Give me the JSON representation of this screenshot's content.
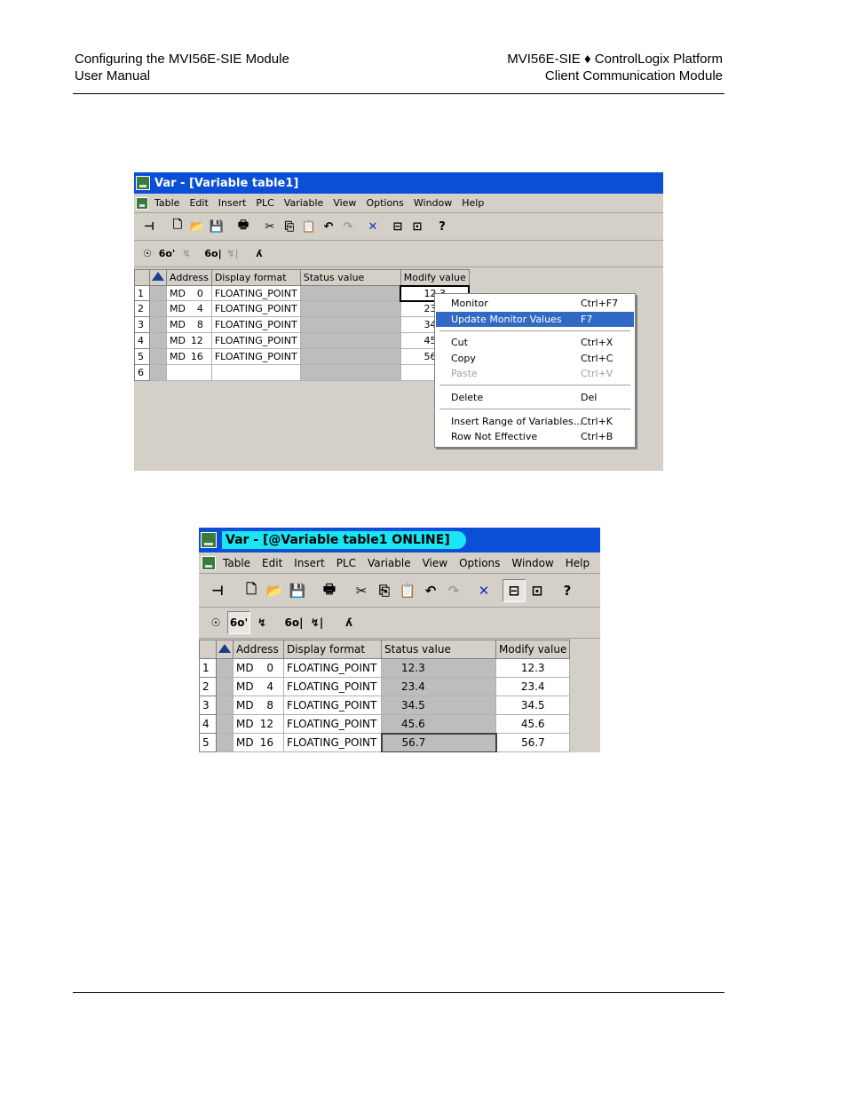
{
  "header": {
    "left_line1": "Configuring the MVI56E-SIE Module",
    "left_line2": "User Manual",
    "right_line1": "MVI56E-SIE ♦ ControlLogix Platform",
    "right_line2": "Client Communication Module"
  },
  "window1": {
    "title": "Var - [Variable table1]",
    "menu": [
      "Table",
      "Edit",
      "Insert",
      "PLC",
      "Variable",
      "View",
      "Options",
      "Window",
      "Help"
    ],
    "columns": [
      "Address",
      "Display format",
      "Status value",
      "Modify value"
    ],
    "rows": [
      {
        "n": "1",
        "area": "MD",
        "addr": "0",
        "format": "FLOATING_POINT",
        "status": "",
        "modify": "12.3"
      },
      {
        "n": "2",
        "area": "MD",
        "addr": "4",
        "format": "FLOATING_POINT",
        "status": "",
        "modify": "23.4"
      },
      {
        "n": "3",
        "area": "MD",
        "addr": "8",
        "format": "FLOATING_POINT",
        "status": "",
        "modify": "34.5"
      },
      {
        "n": "4",
        "area": "MD",
        "addr": "12",
        "format": "FLOATING_POINT",
        "status": "",
        "modify": "45.6"
      },
      {
        "n": "5",
        "area": "MD",
        "addr": "16",
        "format": "FLOATING_POINT",
        "status": "",
        "modify": "56.7"
      },
      {
        "n": "6",
        "area": "",
        "addr": "",
        "format": "",
        "status": "",
        "modify": ""
      }
    ],
    "context_menu": [
      {
        "label": "Monitor",
        "shortcut": "Ctrl+F7"
      },
      {
        "label": "Update Monitor Values",
        "shortcut": "F7"
      },
      {
        "label": "Cut",
        "shortcut": "Ctrl+X"
      },
      {
        "label": "Copy",
        "shortcut": "Ctrl+C"
      },
      {
        "label": "Paste",
        "shortcut": "Ctrl+V"
      },
      {
        "label": "Delete",
        "shortcut": "Del"
      },
      {
        "label": "Insert Range of Variables...",
        "shortcut": "Ctrl+K"
      },
      {
        "label": "Row Not Effective",
        "shortcut": "Ctrl+B"
      }
    ]
  },
  "window2": {
    "title": "Var - [@Variable table1  ONLINE]",
    "menu": [
      "Table",
      "Edit",
      "Insert",
      "PLC",
      "Variable",
      "View",
      "Options",
      "Window",
      "Help"
    ],
    "columns": [
      "Address",
      "Display format",
      "Status value",
      "Modify value"
    ],
    "rows": [
      {
        "n": "1",
        "area": "MD",
        "addr": "0",
        "format": "FLOATING_POINT",
        "status": "12.3",
        "modify": "12.3"
      },
      {
        "n": "2",
        "area": "MD",
        "addr": "4",
        "format": "FLOATING_POINT",
        "status": "23.4",
        "modify": "23.4"
      },
      {
        "n": "3",
        "area": "MD",
        "addr": "8",
        "format": "FLOATING_POINT",
        "status": "34.5",
        "modify": "34.5"
      },
      {
        "n": "4",
        "area": "MD",
        "addr": "12",
        "format": "FLOATING_POINT",
        "status": "45.6",
        "modify": "45.6"
      },
      {
        "n": "5",
        "area": "MD",
        "addr": "16",
        "format": "FLOATING_POINT",
        "status": "56.7",
        "modify": "56.7"
      }
    ]
  },
  "toolbar_icons": {
    "pin": "⊣",
    "new": "🗋",
    "open": "📂",
    "save": "💾",
    "print": "🖶",
    "cut": "✂",
    "copy": "⎘",
    "paste": "📋",
    "undo": "↶",
    "redo": "↷",
    "delete": "✕",
    "online": "⊟",
    "station": "⊡",
    "help": "?",
    "monitor": "☉",
    "glasses": "6o'",
    "modify": "↯",
    "trigger_glasses": "6o|",
    "trigger_modify": "↯|",
    "force": "ʎ"
  },
  "colors": {
    "title_blue": "#0a4fd6",
    "online_highlight": "#19e6f5",
    "menu_highlight": "#316ac5",
    "window_bg": "#d4d0c8"
  }
}
